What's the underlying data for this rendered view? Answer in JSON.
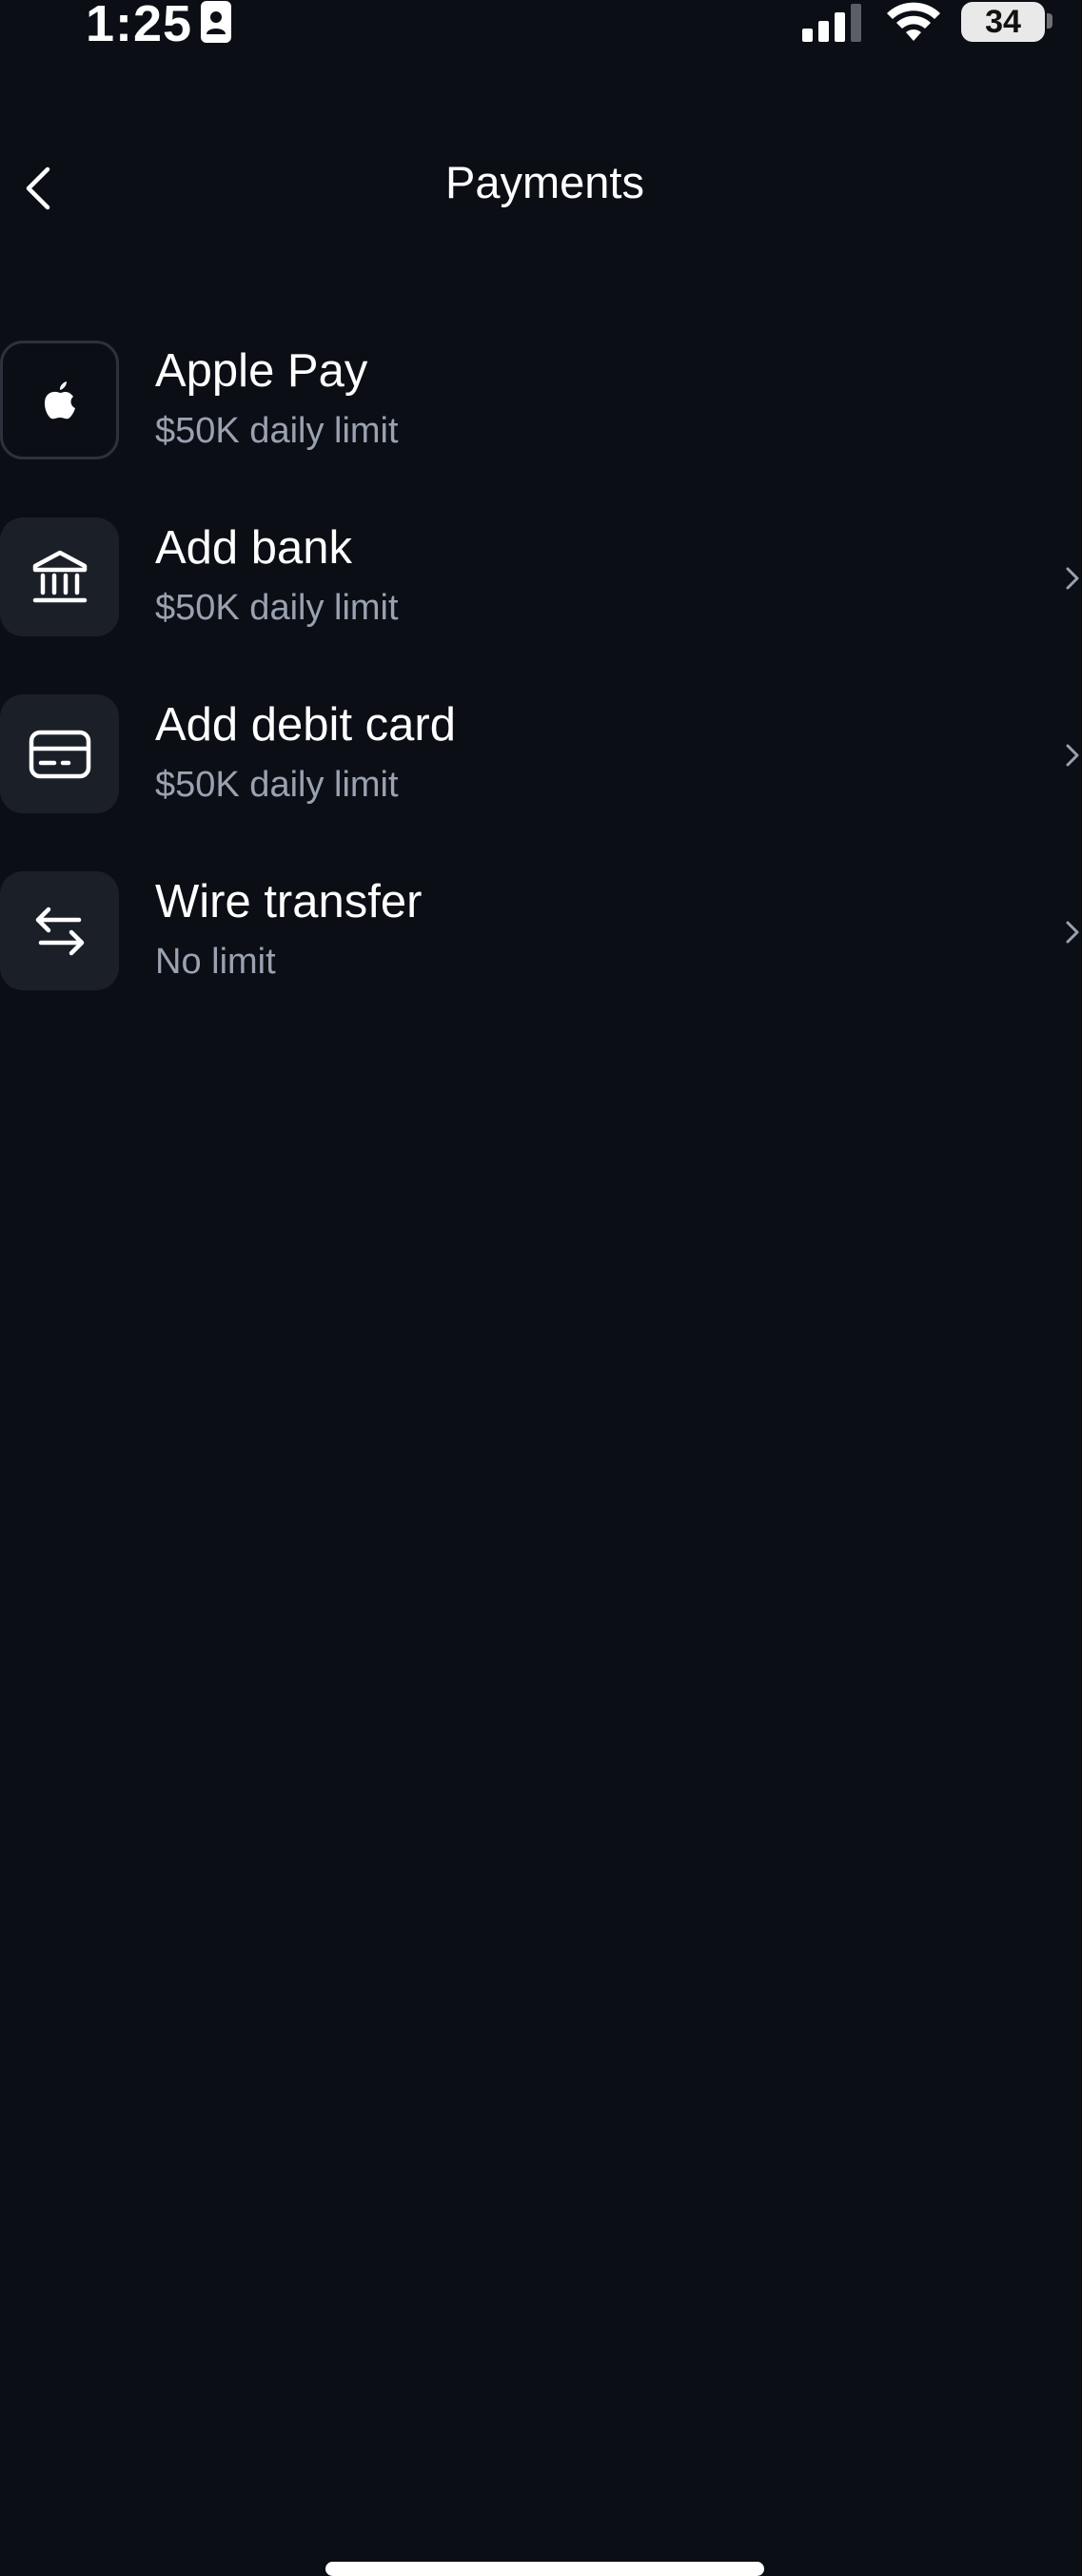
{
  "status_bar": {
    "time": "1:25",
    "battery": "34"
  },
  "header": {
    "title": "Payments"
  },
  "methods": [
    {
      "title": "Apple Pay",
      "subtitle": "$50K daily limit",
      "icon": "apple-icon"
    },
    {
      "title": "Add bank",
      "subtitle": "$50K daily limit",
      "icon": "bank-icon"
    },
    {
      "title": "Add debit card",
      "subtitle": "$50K daily limit",
      "icon": "credit-card-icon"
    },
    {
      "title": "Wire transfer",
      "subtitle": "No limit",
      "icon": "transfer-arrows-icon"
    }
  ],
  "colors": {
    "background": "#0b0e15",
    "icon_tile": "#1b1f28",
    "subtitle": "#9aa2b1"
  }
}
